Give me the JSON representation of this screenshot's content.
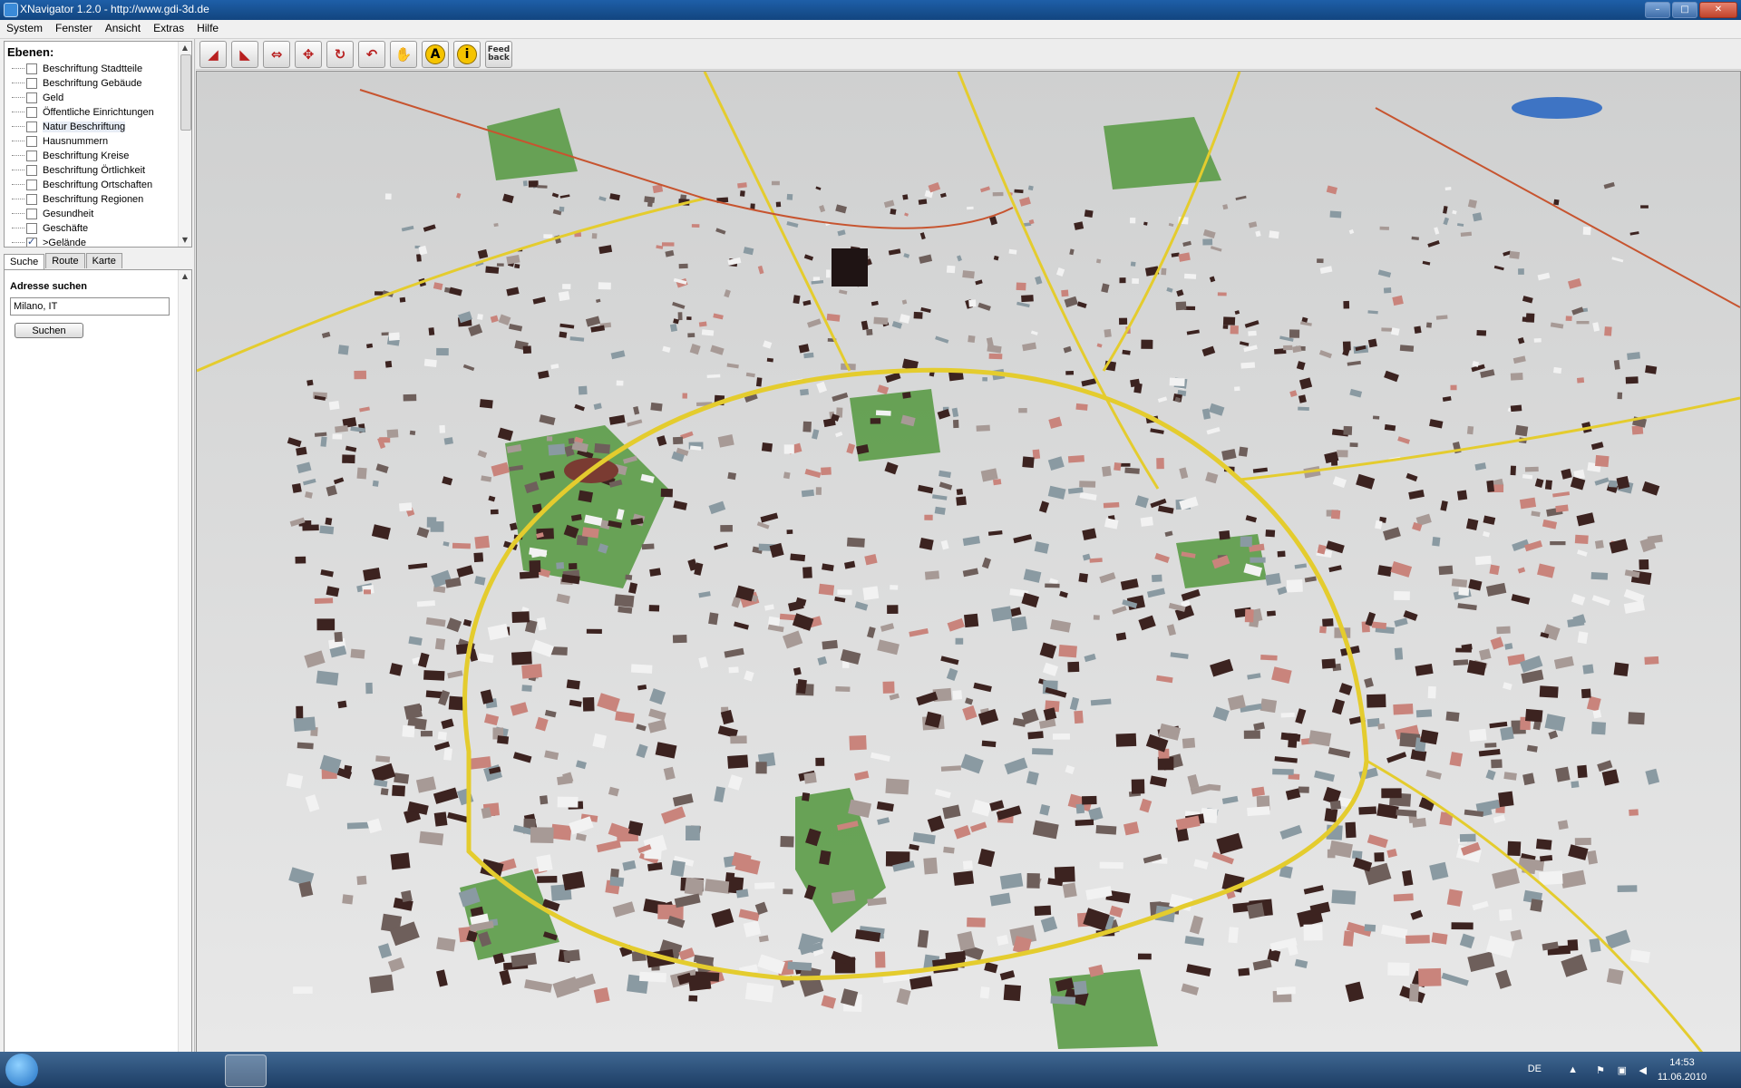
{
  "window": {
    "title": "XNavigator 1.2.0 - http://www.gdi-3d.de"
  },
  "menu": [
    "System",
    "Fenster",
    "Ansicht",
    "Extras",
    "Hilfe"
  ],
  "layers": {
    "heading": "Ebenen:",
    "items": [
      {
        "label": "Beschriftung Stadtteile",
        "checked": false
      },
      {
        "label": "Beschriftung Gebäude",
        "checked": false
      },
      {
        "label": "Geld",
        "checked": false
      },
      {
        "label": "Öffentliche Einrichtungen",
        "checked": false
      },
      {
        "label": "Natur Beschriftung",
        "checked": false,
        "selected": true
      },
      {
        "label": "Hausnummern",
        "checked": false
      },
      {
        "label": "Beschriftung Kreise",
        "checked": false
      },
      {
        "label": "Beschriftung Örtlichkeit",
        "checked": false
      },
      {
        "label": "Beschriftung Ortschaften",
        "checked": false
      },
      {
        "label": "Beschriftung Regionen",
        "checked": false
      },
      {
        "label": "Gesundheit",
        "checked": false
      },
      {
        "label": "Geschäfte",
        "checked": false
      },
      {
        "label": ">Gelände",
        "checked": true
      }
    ]
  },
  "tabs": [
    "Suche",
    "Route",
    "Karte"
  ],
  "search": {
    "heading": "Adresse suchen",
    "value": "Milano, IT",
    "button": "Suchen"
  },
  "toolbar": {
    "tools": [
      "tilt-up",
      "tilt-down",
      "pan-horizontal",
      "pan-all",
      "rotate",
      "return",
      "hand",
      "label",
      "info"
    ],
    "feedback": "Feed back"
  },
  "taskbar": {
    "lang": "DE",
    "time": "14:53",
    "date": "11.06.2010"
  },
  "colors": {
    "green": "#5b9b47",
    "road_yellow": "#e4cc2e",
    "road_red": "#c7542f",
    "building_dark": "#3c2320",
    "building_pink": "#c9847c",
    "building_gray": "#8a9aa2",
    "water": "#3e74c4"
  }
}
